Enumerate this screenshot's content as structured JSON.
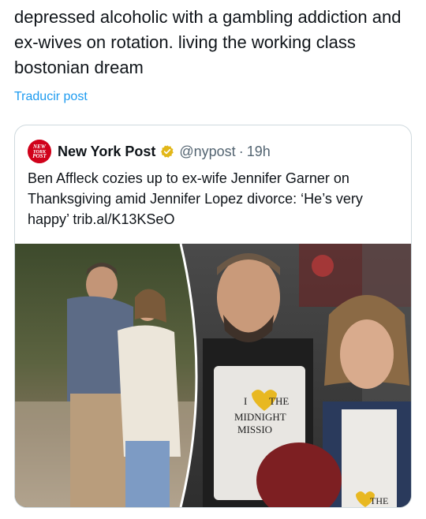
{
  "tweet": {
    "text": "depressed alcoholic with a gambling addiction and ex-wives on rotation. living the working class bostonian dream",
    "translate_label": "Traducir post"
  },
  "quote": {
    "author_name": "New York Post",
    "handle": "@nypost",
    "separator": "·",
    "time": "19h",
    "avatar_logo_text": "NEW YORK POST",
    "text": "Ben Affleck cozies up to ex-wife Jennifer Garner on Thanksgiving amid Jennifer Lopez divorce: ‘He’s very happy’ trib.al/K13KSeO",
    "media": {
      "apron_line1": "I",
      "apron_line2": "THE",
      "apron_line3": "MIDNIGHT",
      "apron_line4": "MISSIO",
      "apron2_text": "THE"
    }
  },
  "colors": {
    "link": "#1d9bf0",
    "brand_red": "#d0021b",
    "verified_gold": "#e2b719"
  }
}
